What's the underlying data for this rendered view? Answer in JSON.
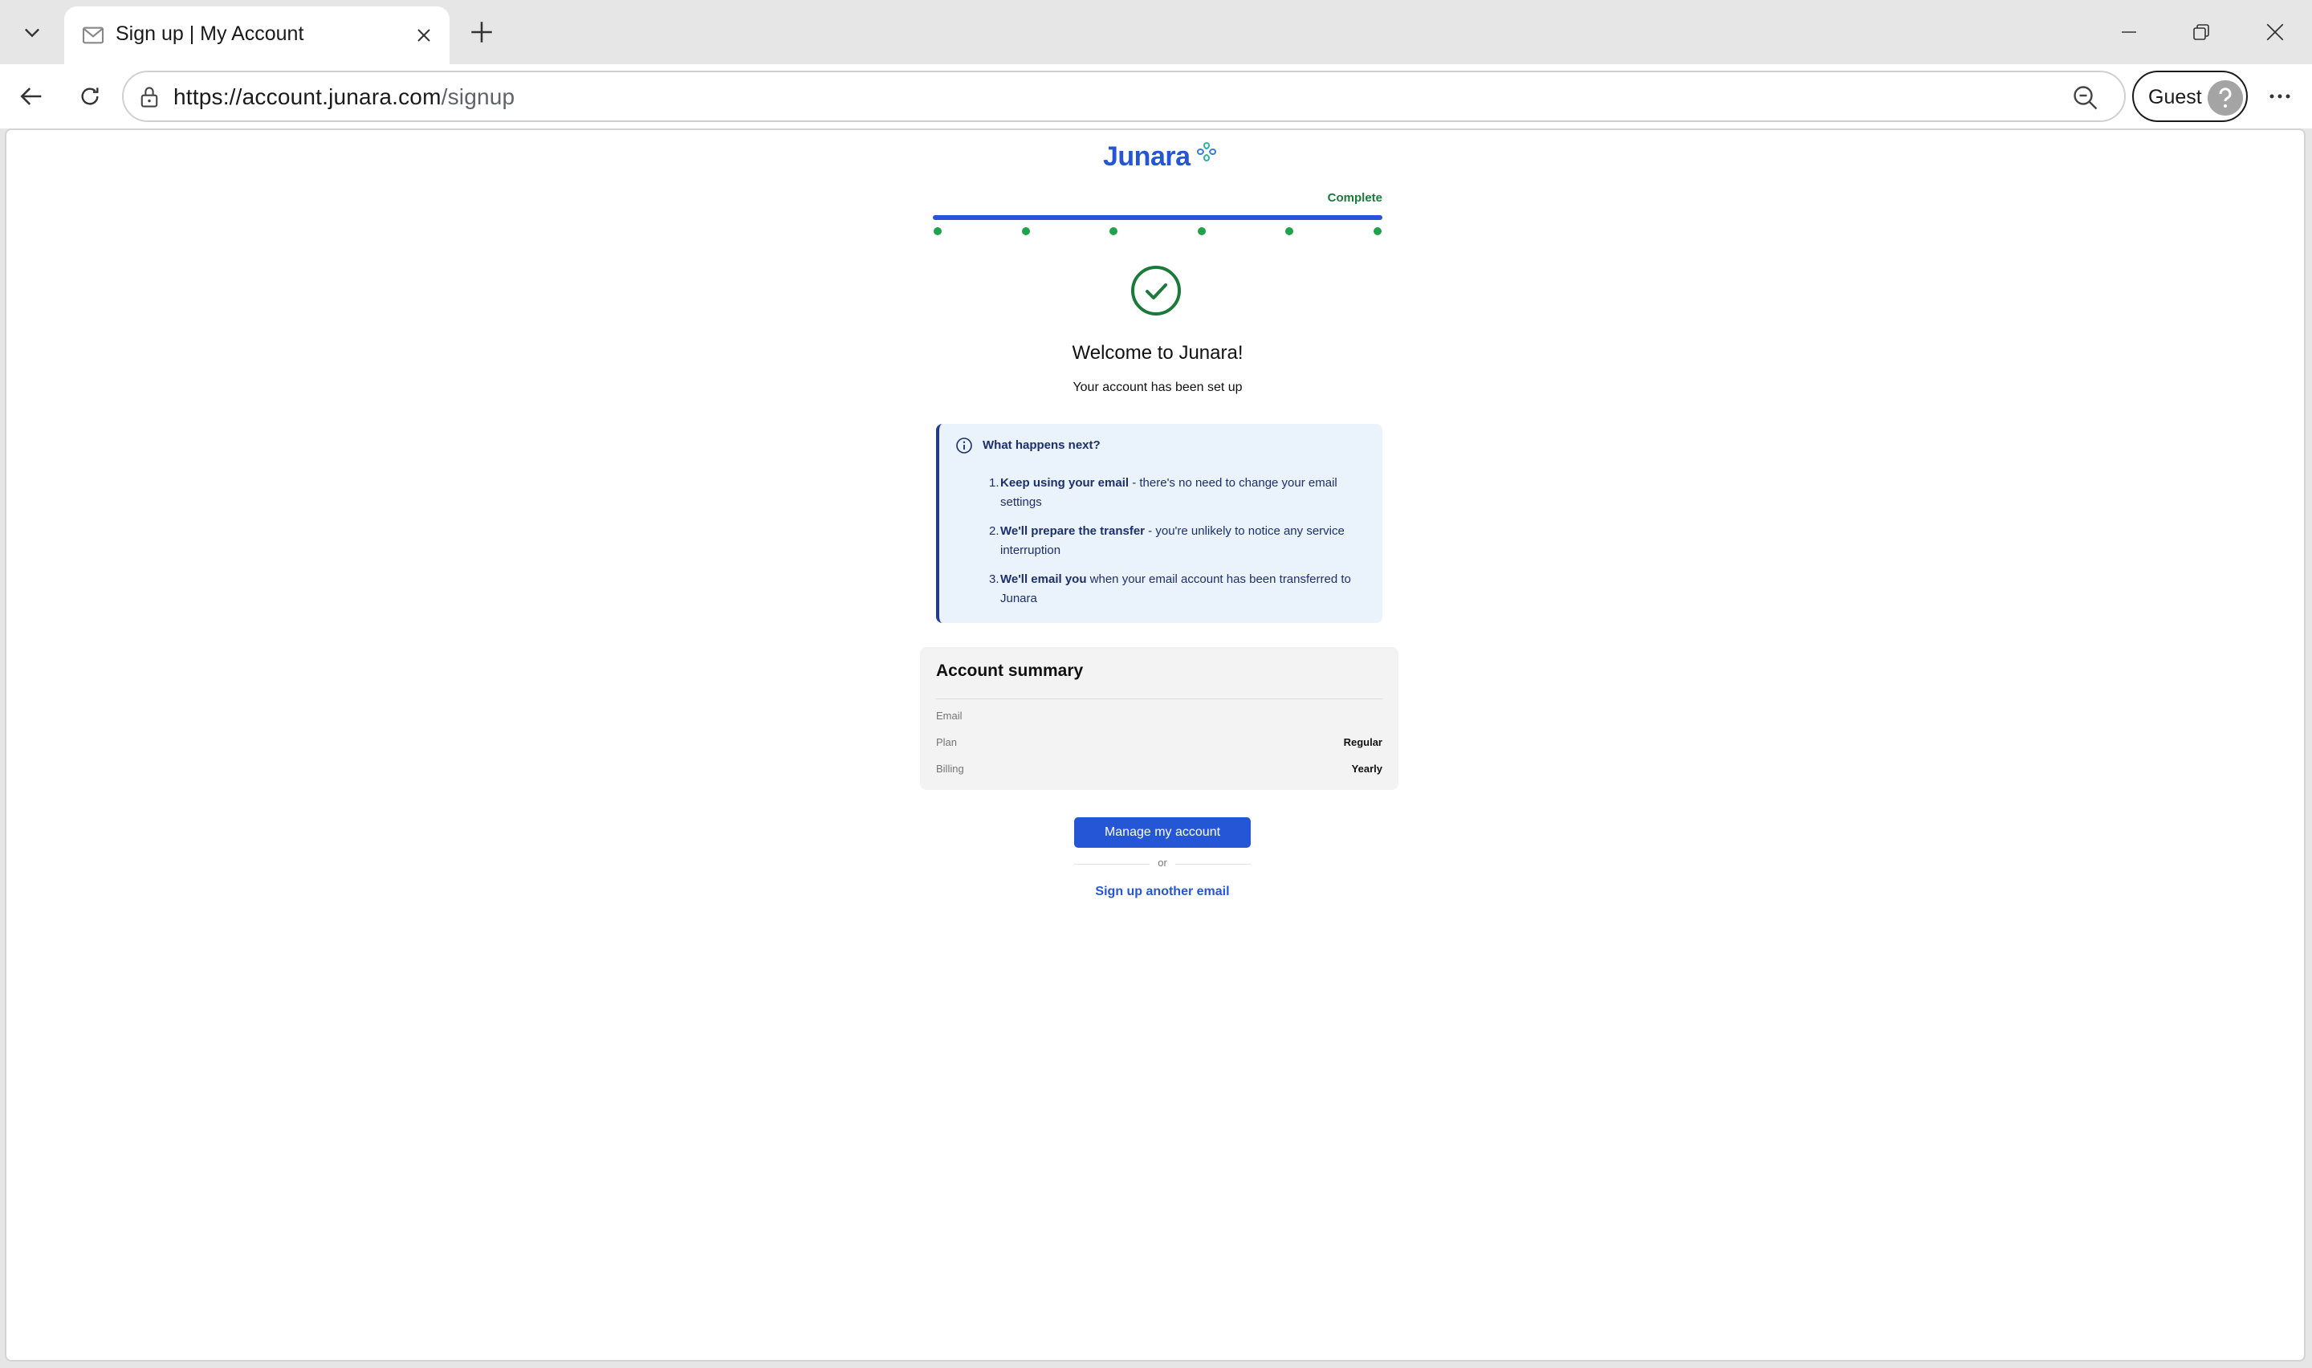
{
  "browser": {
    "tab": {
      "title": "Sign up | My Account",
      "favicon": "mail-icon"
    },
    "address": {
      "url_host": "https://account.junara.com",
      "url_path": "/signup"
    },
    "profile_label": "Guest"
  },
  "page": {
    "logo_text": "Junara",
    "progress": {
      "label": "Complete",
      "steps_total": 6,
      "steps_done": 6,
      "fraction": 1.0
    },
    "welcome_title": "Welcome to Junara!",
    "subtitle": "Your account has been set up",
    "next": {
      "title": "What happens next?",
      "items": [
        {
          "num": "1.",
          "bold": "Keep using your email",
          "rest": " - there's no need to change your email settings"
        },
        {
          "num": "2.",
          "bold": "We'll prepare the transfer",
          "rest": " - you're unlikely to notice any service interruption"
        },
        {
          "num": "3.",
          "bold": "We'll email you",
          "rest": " when your email account has been transferred to Junara"
        }
      ]
    },
    "summary": {
      "title": "Account summary",
      "rows": [
        {
          "label": "Email",
          "value": ""
        },
        {
          "label": "Plan",
          "value": "Regular"
        },
        {
          "label": "Billing",
          "value": "Yearly"
        }
      ]
    },
    "manage_button": "Manage my account",
    "or_text": "or",
    "signup_link": "Sign up another email"
  },
  "colors": {
    "brand_blue": "#2456d6",
    "success_green": "#1a7a3a",
    "info_bg": "#eaf2fb",
    "info_text": "#1c2f6e"
  }
}
